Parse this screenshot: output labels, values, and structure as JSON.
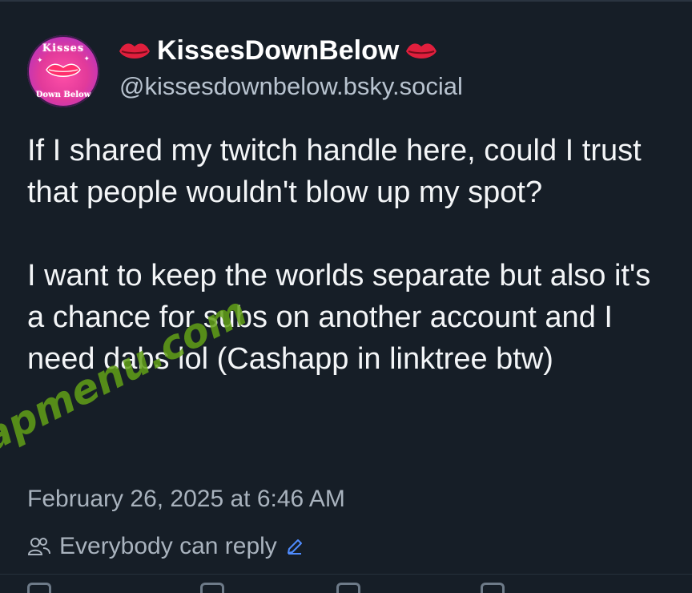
{
  "author": {
    "display_name": "KissesDownBelow",
    "handle": "@kissesdownbelow.bsky.social",
    "name_icon": "kiss-lips-icon",
    "avatar": {
      "top_text": "Kisses",
      "bottom_text": "Down Below"
    }
  },
  "post": {
    "paragraphs": [
      "If I shared my twitch handle here, could I trust that people wouldn't blow up my spot?",
      "I want to keep the worlds separate but also it's a chance for subs on another account and I need dabs lol (Cashapp in linktree btw)"
    ],
    "timestamp": "February 26, 2025 at 6:46 AM",
    "reply_setting": "Everybody can reply",
    "reply_icon": "people-icon",
    "edit_icon": "pencil-icon"
  },
  "watermark": "fapmenu.com",
  "colors": {
    "background": "#161e27",
    "text": "#f3f5f7",
    "muted": "#a9b3be",
    "accent": "#e23a5a"
  }
}
